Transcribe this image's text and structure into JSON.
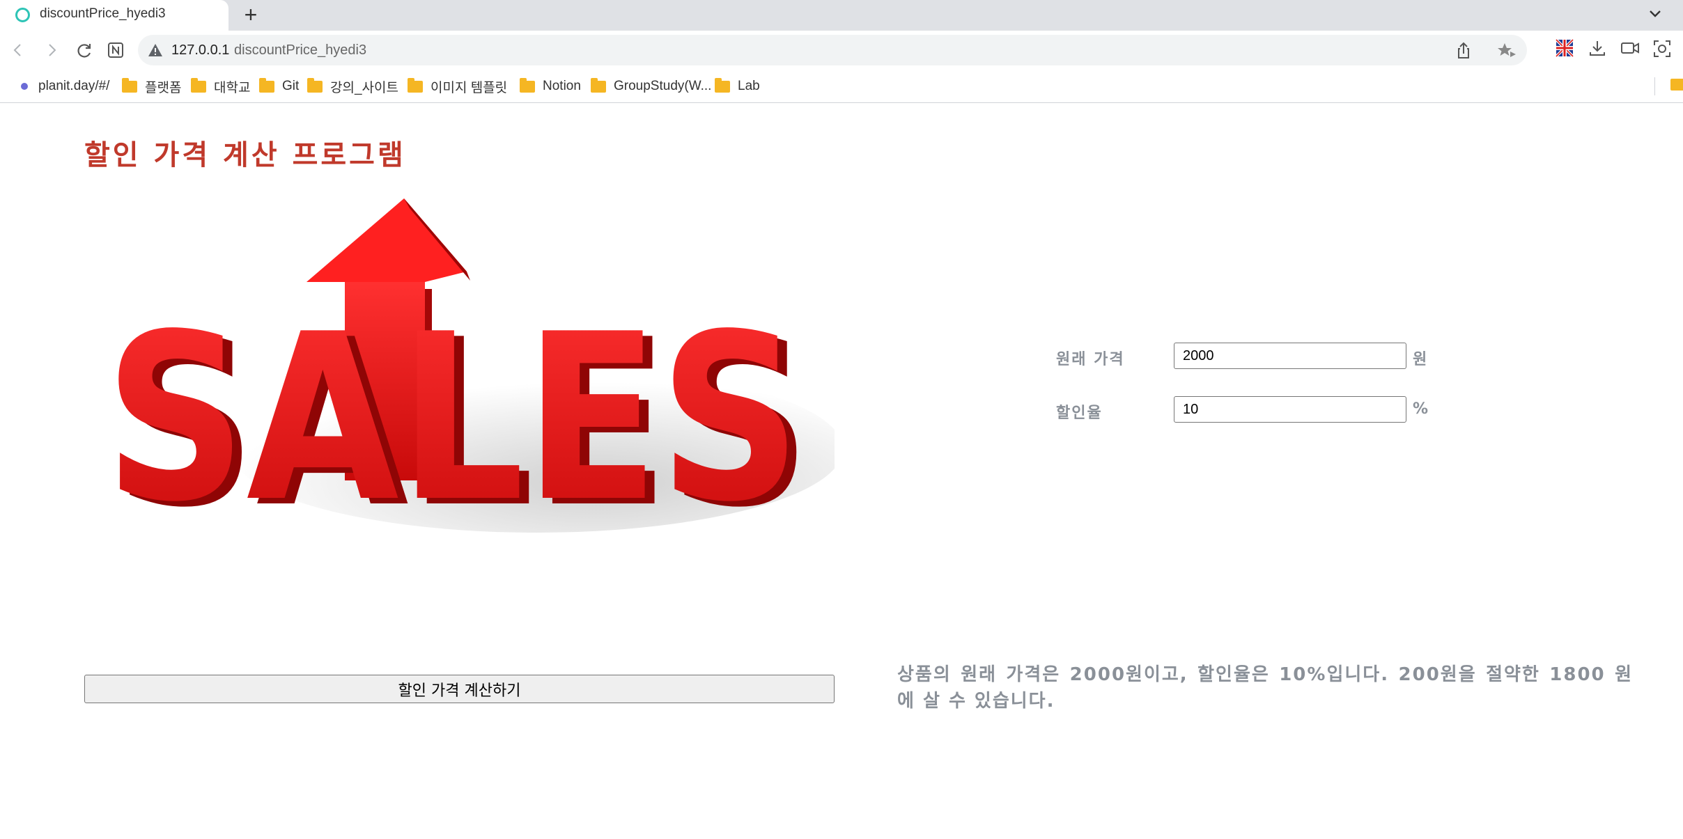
{
  "browser": {
    "tab_title": "discountPrice_hyedi3",
    "new_tab_label": "+",
    "url_host": "127.0.0.1",
    "url_path": "discountPrice_hyedi3",
    "bookmarks": [
      {
        "label": "planit.day/#/",
        "type": "site"
      },
      {
        "label": "플랫폼",
        "type": "folder"
      },
      {
        "label": "대학교",
        "type": "folder"
      },
      {
        "label": "Git",
        "type": "folder"
      },
      {
        "label": "강의_사이트",
        "type": "folder"
      },
      {
        "label": "이미지 템플릿",
        "type": "folder"
      },
      {
        "label": "Notion",
        "type": "folder"
      },
      {
        "label": "GroupStudy(W...",
        "type": "folder"
      },
      {
        "label": "Lab",
        "type": "folder"
      }
    ]
  },
  "page": {
    "title": "할인 가격 계산 프로그램",
    "hero_image": {
      "icon": "sales-arrow-image",
      "text": "SALES"
    },
    "form": {
      "original_price": {
        "label": "원래 가격",
        "value": "2000",
        "unit": "원"
      },
      "discount_rate": {
        "label": "할인율",
        "value": "10",
        "unit": "%"
      }
    },
    "calc_button_label": "할인 가격 계산하기",
    "result_text": "상품의 원래 가격은 2000원이고, 할인율은 10%입니다. 200원을 절약한 1800 원에 살 수 있습니다."
  },
  "colors": {
    "title": "#c0392b",
    "label": "#8a9098",
    "sales_red": "#e31b1b",
    "folder": "#f5b623"
  }
}
